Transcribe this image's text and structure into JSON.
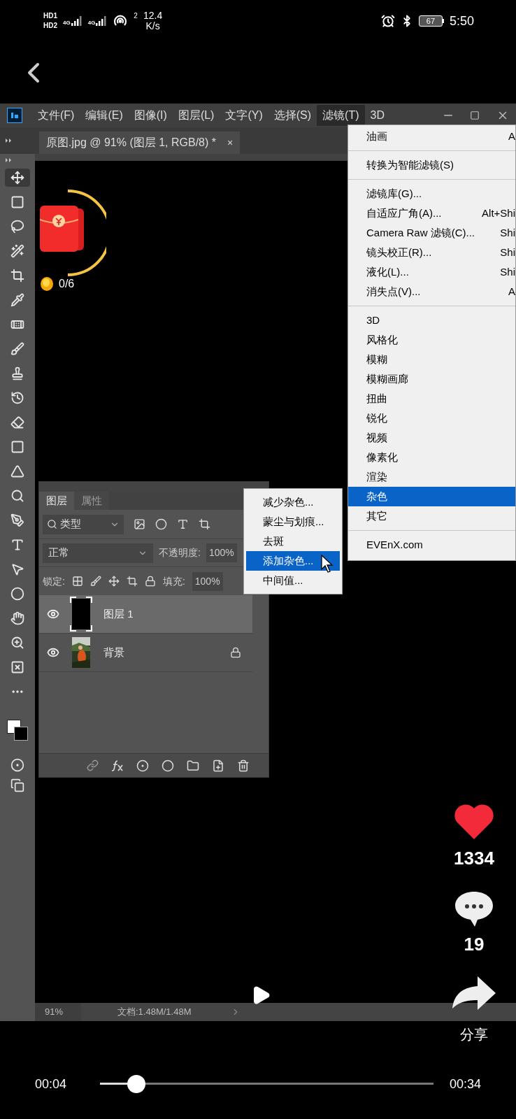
{
  "status_bar": {
    "sims": [
      {
        "hd": "HD",
        "slot": "1",
        "network": "4G"
      },
      {
        "hd": "HD",
        "slot": "2",
        "network": "4G"
      }
    ],
    "hotspot_count": "2",
    "speed": "12.4",
    "speed_unit": "K/s",
    "battery": "67",
    "time": "5:50"
  },
  "photoshop": {
    "menu": [
      {
        "label": "文件(F)",
        "selected": false
      },
      {
        "label": "编辑(E)",
        "selected": false
      },
      {
        "label": "图像(I)",
        "selected": false
      },
      {
        "label": "图层(L)",
        "selected": false
      },
      {
        "label": "文字(Y)",
        "selected": false
      },
      {
        "label": "选择(S)",
        "selected": false
      },
      {
        "label": "滤镜(T)",
        "selected": true
      },
      {
        "label": "3D",
        "selected": false
      }
    ],
    "document_tab": {
      "title": "原图.jpg @ 91% (图层 1, RGB/8) *",
      "close": "×"
    },
    "filter_menu": [
      [
        {
          "label": "油画",
          "shortcut": "A",
          "selected": false
        }
      ],
      [
        {
          "label": "转换为智能滤镜(S)",
          "selected": false
        }
      ],
      [
        {
          "label": "滤镜库(G)...",
          "selected": false
        },
        {
          "label": "自适应广角(A)...",
          "shortcut": "Alt+Shi",
          "selected": false
        },
        {
          "label": "Camera Raw 滤镜(C)...",
          "shortcut": "Shi",
          "selected": false
        },
        {
          "label": "镜头校正(R)...",
          "shortcut": "Shi",
          "selected": false
        },
        {
          "label": "液化(L)...",
          "shortcut": "Shi",
          "selected": false
        },
        {
          "label": "消失点(V)...",
          "shortcut": "A",
          "selected": false
        }
      ],
      [
        {
          "label": "3D",
          "selected": false
        },
        {
          "label": "风格化",
          "selected": false
        },
        {
          "label": "模糊",
          "selected": false
        },
        {
          "label": "模糊画廊",
          "selected": false
        },
        {
          "label": "扭曲",
          "selected": false
        },
        {
          "label": "锐化",
          "selected": false
        },
        {
          "label": "视频",
          "selected": false
        },
        {
          "label": "像素化",
          "selected": false
        },
        {
          "label": "渲染",
          "selected": false
        },
        {
          "label": "杂色",
          "selected": true
        },
        {
          "label": "其它",
          "selected": false
        }
      ],
      [
        {
          "label": "EVEnX.com",
          "selected": false
        }
      ]
    ],
    "noise_submenu": [
      {
        "label": "减少杂色...",
        "selected": false
      },
      {
        "label": "蒙尘与划痕...",
        "selected": false
      },
      {
        "label": "去斑",
        "selected": false
      },
      {
        "label": "添加杂色...",
        "selected": true
      },
      {
        "label": "中间值...",
        "selected": false
      }
    ],
    "layers_panel": {
      "tabs": [
        {
          "label": "图层",
          "selected": true
        },
        {
          "label": "属性",
          "selected": false
        }
      ],
      "filter": "类型",
      "blend_mode": "正常",
      "opacity_label": "不透明度:",
      "opacity": "100%",
      "lock_label": "锁定:",
      "fill_label": "填充:",
      "fill": "100%",
      "layers": [
        {
          "name": "图层 1",
          "kind": "blank",
          "visible": true,
          "locked": false,
          "selected": true
        },
        {
          "name": "背景",
          "visible": true,
          "locked": true,
          "selected": false
        }
      ]
    },
    "status": {
      "zoom": "91%",
      "document": "文档:1.48M/1.48M"
    }
  },
  "overlay": {
    "reward": "0/6",
    "likes": "1334",
    "comments": "19",
    "share": "分享"
  },
  "player": {
    "current": "00:04",
    "total": "00:34",
    "level": 0.11
  }
}
